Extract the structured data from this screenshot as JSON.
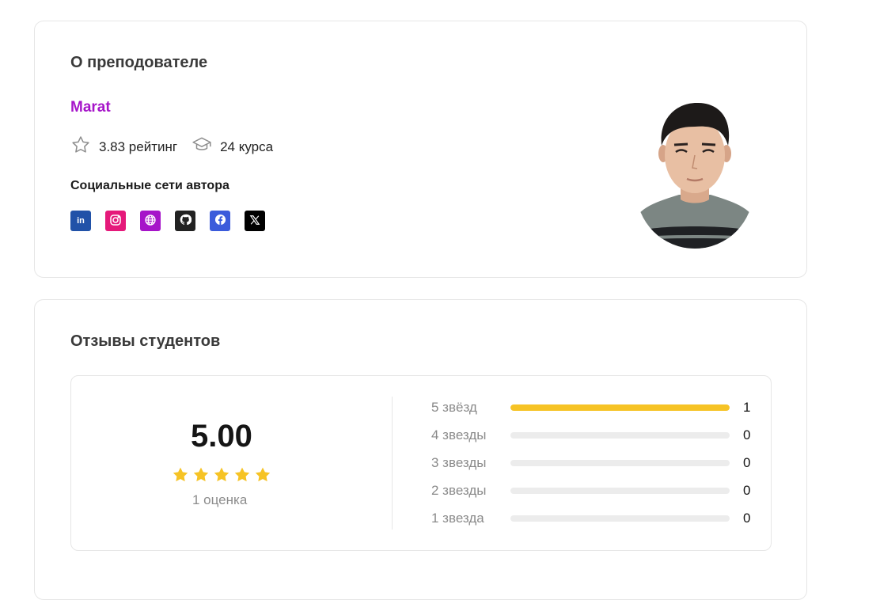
{
  "teacher_section": {
    "title": "О преподователе",
    "name": "Marat",
    "rating_text": "3.83 рейтинг",
    "courses_text": "24 курса",
    "social_title": "Социальные сети автора",
    "socials": [
      {
        "name": "linkedin",
        "icon": "linkedin-icon",
        "color": "#2152a8"
      },
      {
        "name": "instagram",
        "icon": "instagram-icon",
        "color": "#e5197a"
      },
      {
        "name": "website",
        "icon": "globe-icon",
        "color": "#a614c9"
      },
      {
        "name": "github",
        "icon": "github-icon",
        "color": "#222222"
      },
      {
        "name": "facebook",
        "icon": "facebook-icon",
        "color": "#3b5bdb"
      },
      {
        "name": "x",
        "icon": "x-icon",
        "color": "#000000"
      }
    ],
    "accent_color": "#a614c9"
  },
  "reviews_section": {
    "title": "Отзывы студентов",
    "average": "5.00",
    "stars_filled": 5,
    "count_text": "1 оценка",
    "star_color": "#f6c325",
    "distribution": [
      {
        "label": "5 звёзд",
        "count": "1",
        "fraction": 1.0
      },
      {
        "label": "4 звезды",
        "count": "0",
        "fraction": 0
      },
      {
        "label": "3 звезды",
        "count": "0",
        "fraction": 0
      },
      {
        "label": "2 звезды",
        "count": "0",
        "fraction": 0
      },
      {
        "label": "1 звезда",
        "count": "0",
        "fraction": 0
      }
    ]
  }
}
